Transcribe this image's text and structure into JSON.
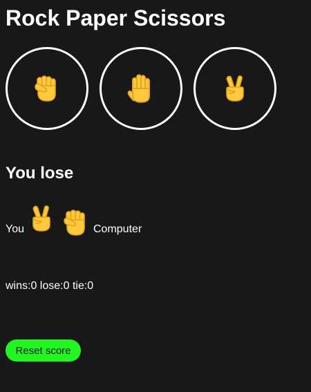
{
  "title": "Rock Paper Scissors",
  "choices": [
    {
      "name": "rock",
      "icon": "raised-fist-icon"
    },
    {
      "name": "paper",
      "icon": "raised-hand-icon"
    },
    {
      "name": "scissors",
      "icon": "victory-hand-icon"
    }
  ],
  "result": "You lose",
  "match": {
    "you_label": "You",
    "you_choice_icon": "victory-hand-icon",
    "computer_choice_icon": "raised-fist-icon",
    "computer_label": "Computer"
  },
  "score": "wins:0 lose:0 tie:0",
  "reset_label": "Reset score",
  "colors": {
    "background": "#181818",
    "emoji": "#FFC83D",
    "reset_button": "#22F522"
  }
}
